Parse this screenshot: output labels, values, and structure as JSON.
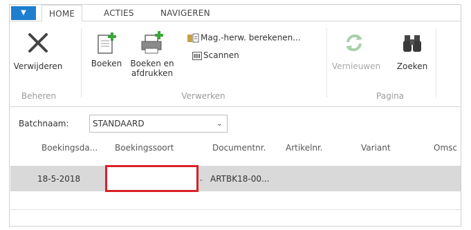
{
  "ribbon_tabs": {
    "home": "HOME",
    "acties": "ACTIES",
    "navigeren": "NAVIGEREN"
  },
  "app_button_glyph": "▼",
  "buttons": {
    "verwijderen": "Verwijderen",
    "boeken": "Boeken",
    "boeken_afdrukken_line1": "Boeken en",
    "boeken_afdrukken_line2": "afdrukken",
    "mag_herw": "Mag.-herw. berekenen...",
    "scannen": "Scannen",
    "vernieuwen": "Vernieuwen",
    "zoeken": "Zoeken"
  },
  "groups": {
    "beheren": "Beheren",
    "verwerken": "Verwerken",
    "pagina": "Pagina"
  },
  "batch": {
    "label": "Batchnaam:",
    "value": "STANDAARD"
  },
  "columns": [
    "Boekingsda...",
    "Boekingssoort",
    "Documentnr.",
    "Artikelnr.",
    "Variant",
    "Omsc"
  ],
  "row": {
    "boekingsdatum": "18-5-2018",
    "boekingssoort": "",
    "documentnr": "ARTBK18-00..."
  },
  "colors": {
    "accent": "#1e7fcf",
    "highlight": "#d92027",
    "row_bg": "#d9d9d9"
  },
  "icons": [
    "delete-x-icon",
    "post-icon",
    "post-print-icon",
    "calc-inventory-icon",
    "scan-icon",
    "refresh-icon",
    "binoculars-icon"
  ]
}
